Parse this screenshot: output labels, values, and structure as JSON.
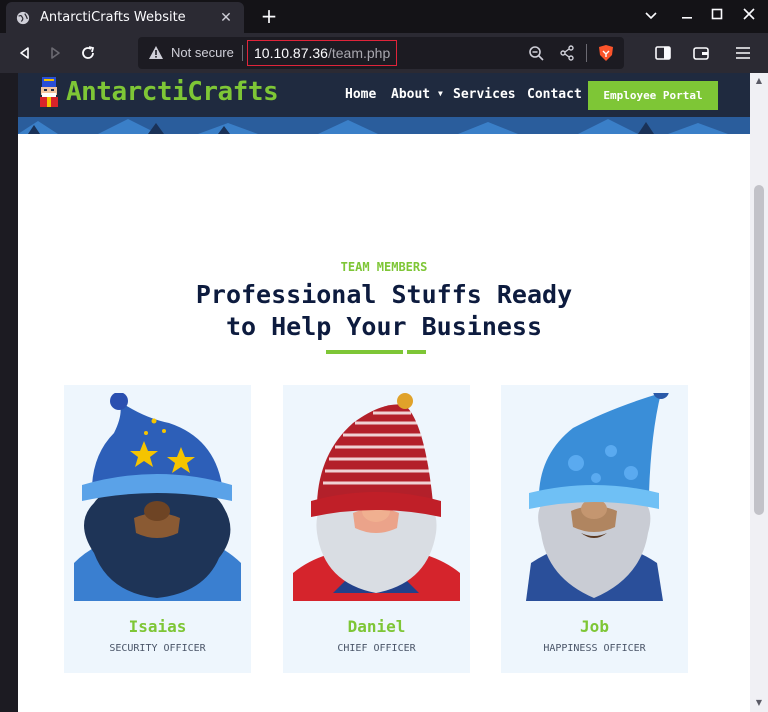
{
  "browser": {
    "tab_title": "AntarctiCrafts Website",
    "url_security": "Not secure",
    "url_host": "10.10.87.36",
    "url_path": "/team.php"
  },
  "site": {
    "logo_text": "AntarctiCrafts",
    "nav": {
      "home": "Home",
      "about": "About",
      "services": "Services",
      "contact": "Contact",
      "portal": "Employee Portal"
    }
  },
  "team": {
    "tag": "TEAM MEMBERS",
    "title_line1": "Professional Stuffs Ready",
    "title_line2": "to Help Your Business",
    "members": [
      {
        "name": "Isaias",
        "role": "SECURITY OFFICER"
      },
      {
        "name": "Daniel",
        "role": "CHIEF OFFICER"
      },
      {
        "name": "Job",
        "role": "HAPPINESS OFFICER"
      }
    ]
  },
  "colors": {
    "accent": "#7ec636",
    "heading": "#0d1b3e",
    "header_bg": "#1f2a3f",
    "card_bg": "#eef6fd"
  },
  "icons": [
    "globe-icon",
    "close-icon",
    "plus-icon",
    "back-icon",
    "forward-icon",
    "reload-icon",
    "warning-icon",
    "zoom-icon",
    "share-icon",
    "brave-shield-icon",
    "sidebar-icon",
    "wallet-icon",
    "menu-icon"
  ]
}
